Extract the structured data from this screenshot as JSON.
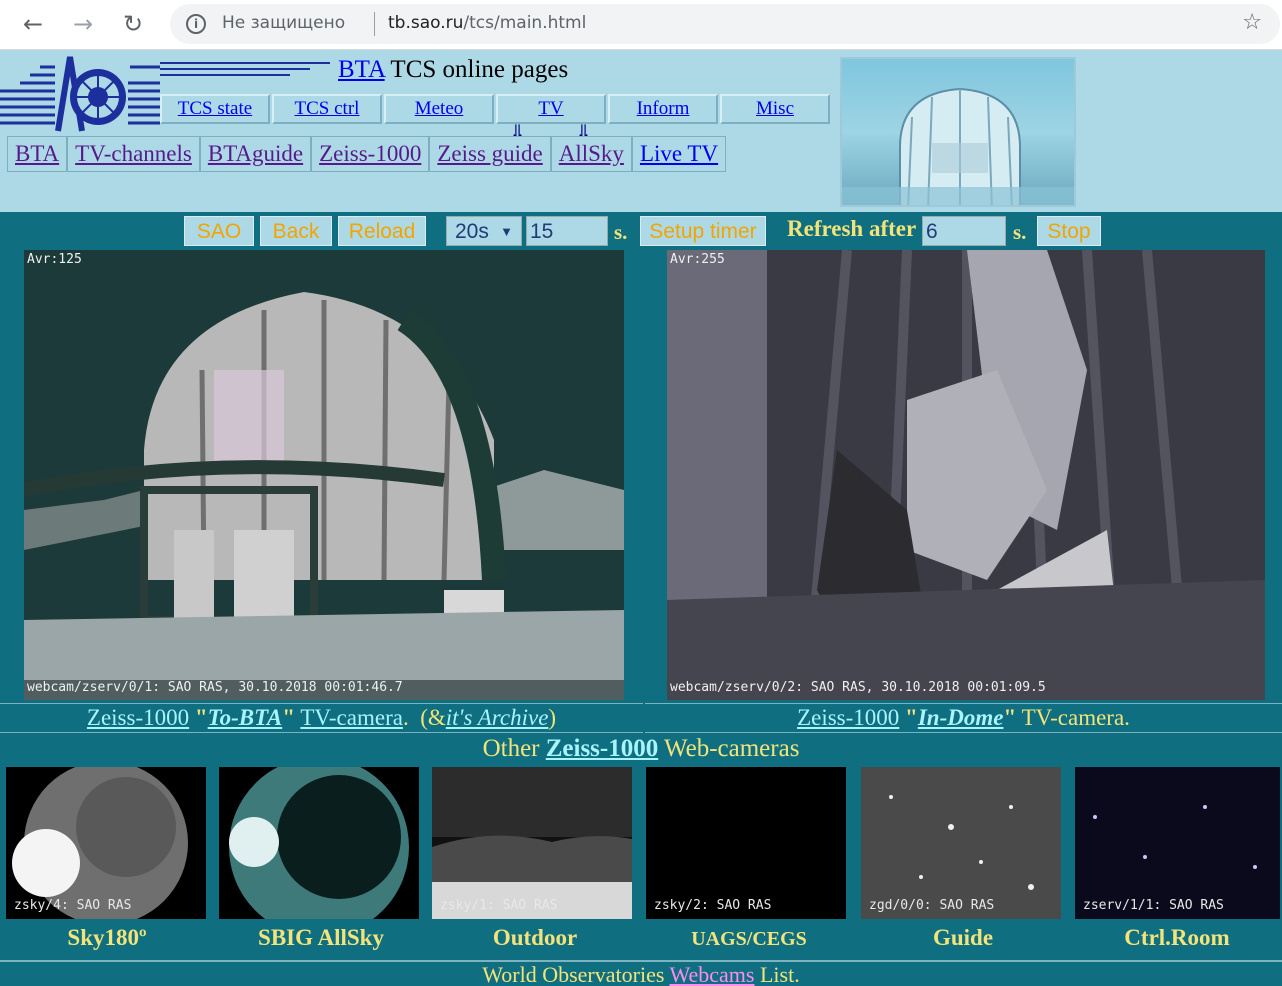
{
  "browser": {
    "security_text": "Не защищено",
    "url_host": "tb.sao.ru",
    "url_path": "/tcs/main.html"
  },
  "header": {
    "site_title_link": "BTA",
    "site_title_rest": " TCS online pages",
    "menu_top": [
      "TCS state",
      "TCS ctrl",
      "Meteo",
      "TV",
      "Inform",
      "Misc"
    ],
    "menu_bottom": [
      "BTA",
      "TV-channels",
      "BTAguide",
      "Zeiss-1000",
      "Zeiss guide",
      "AllSky",
      "Live TV"
    ],
    "arrow_glyph": "⇓"
  },
  "controls": {
    "sao": "SAO",
    "back": "Back",
    "reload": "Reload",
    "interval_value": "20s",
    "timer_value": "15",
    "unit": "s.",
    "setup_timer": "Setup timer",
    "refresh_label": "Refresh after",
    "refresh_value": "6",
    "stop": "Stop"
  },
  "cameras": [
    {
      "avr": "Avr:125",
      "stamp": "webcam/zserv/0/1: SAO RAS, 30.10.2018 00:01:46.7",
      "cap_link1": "Zeiss-1000",
      "cap_quote": "\"To-BTA\"",
      "cap_link2": "TV-camera",
      "cap_dot": ".",
      "cap_archive_open": "(&",
      "cap_archive": "it's Archive",
      "cap_archive_close": ")"
    },
    {
      "avr": "Avr:255",
      "stamp": "webcam/zserv/0/2: SAO RAS, 30.10.2018 00:01:09.5",
      "cap_link1": "Zeiss-1000",
      "cap_quote": "\"In-Dome\"",
      "cap_rest": "TV-camera."
    }
  ],
  "other": {
    "prefix": "Other ",
    "link": "Zeiss-1000",
    "suffix": " Web-cameras"
  },
  "thumbs": [
    {
      "label": "Sky180º",
      "overlay": "zsky/4: SAO RAS"
    },
    {
      "label": "SBIG AllSky",
      "overlay": ""
    },
    {
      "label": "Outdoor",
      "overlay": "zsky/1: SAO RAS"
    },
    {
      "label": "UAGS/CEGS",
      "overlay": "zsky/2: SAO RAS"
    },
    {
      "label": "Guide",
      "overlay": "zgd/0/0: SAO RAS"
    },
    {
      "label": "Ctrl.Room",
      "overlay": "zserv/1/1: SAO RAS"
    }
  ],
  "footer": {
    "prefix": "World Observatories ",
    "link": "Webcams",
    "suffix": " List."
  }
}
